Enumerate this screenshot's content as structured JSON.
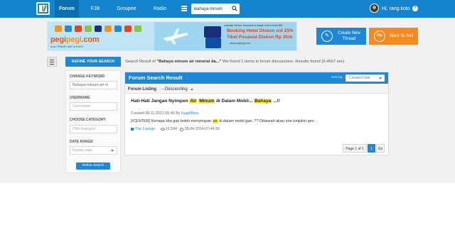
{
  "nav": {
    "logo": "K",
    "items": [
      {
        "label": "Forum",
        "active": true
      },
      {
        "label": "FJB",
        "active": false
      },
      {
        "label": "Groupee",
        "active": false
      },
      {
        "label": "Radio",
        "active": false
      }
    ],
    "search_value": "Bahaya minum",
    "user_greeting": "Hi, rang.koto",
    "help_icon": "?"
  },
  "banner": {
    "brand_a": "pegi",
    "brand_b": "pegi",
    "brand_c": ".com",
    "tagline": "now TRAVELING is EASY",
    "promo_top": "Lakukan Semua Transaksi di bawah Kartu Kredit BRI",
    "promo_hotel": "Booking Hotel Diskon s/d 15%",
    "promo_flight": "Tiket Pesawat Diskon Rp 30rb",
    "promo_url": "www.pegipegi.com"
  },
  "cta": {
    "create_icon": "✎",
    "create_label": "Create New Thread",
    "sell_icon": "Rp",
    "sell_label": "Want To Sell"
  },
  "refine_tab": "REFINE YOUR SEARCH",
  "summary": {
    "prefix": "Search Result of ",
    "query": "\"Bahaya minum air mineral da...\"",
    "suffix": " We found 1 items in forum discussions. Results found (0.4667 sec)"
  },
  "sidebar": {
    "keyword_label": "CHANGE KEYWORD",
    "keyword_value": "Bahaya minum air m",
    "username_label": "USERNAME",
    "username_placeholder": "Username",
    "category_label": "CHOOSE CATEGORY",
    "category_value": "Pilih Kategori",
    "date_label": "DATE RANGE",
    "date_value": "Kapan saja",
    "refine_button": "Refine Search"
  },
  "panel": {
    "title": "Forum Search Result",
    "sortby_label": "Sort by:",
    "sort_value": "Created Date",
    "listing_label": "Forum Listing",
    "listing_sep": "—",
    "listing_order": "Descending"
  },
  "result": {
    "title_1": "Hati-Hati Jangan Nyimpen ",
    "title_hl_1": "Air",
    "title_2": " ",
    "title_hl_2": "Minum",
    "title_3": " di Dalam Mobil... ",
    "title_hl_3": "Bahaya",
    "title_4": " ...!!",
    "created": "Created 08-11-2013 05:46 By ",
    "author": "HageMaru",
    "snippet_1": "[/CENTER] Kenapa kita gak boleh menyimpan ",
    "snippet_hl": "air",
    "snippet_2": " di dalam mobil gan..?? Dibawah akan ane tunjukin pen",
    "category": "The Lounge",
    "views": "16,594",
    "last_post": "28-04-2014 07:44:39"
  },
  "pager": {
    "info": "Page 1 of 1",
    "current": "1",
    "go": "Go"
  }
}
